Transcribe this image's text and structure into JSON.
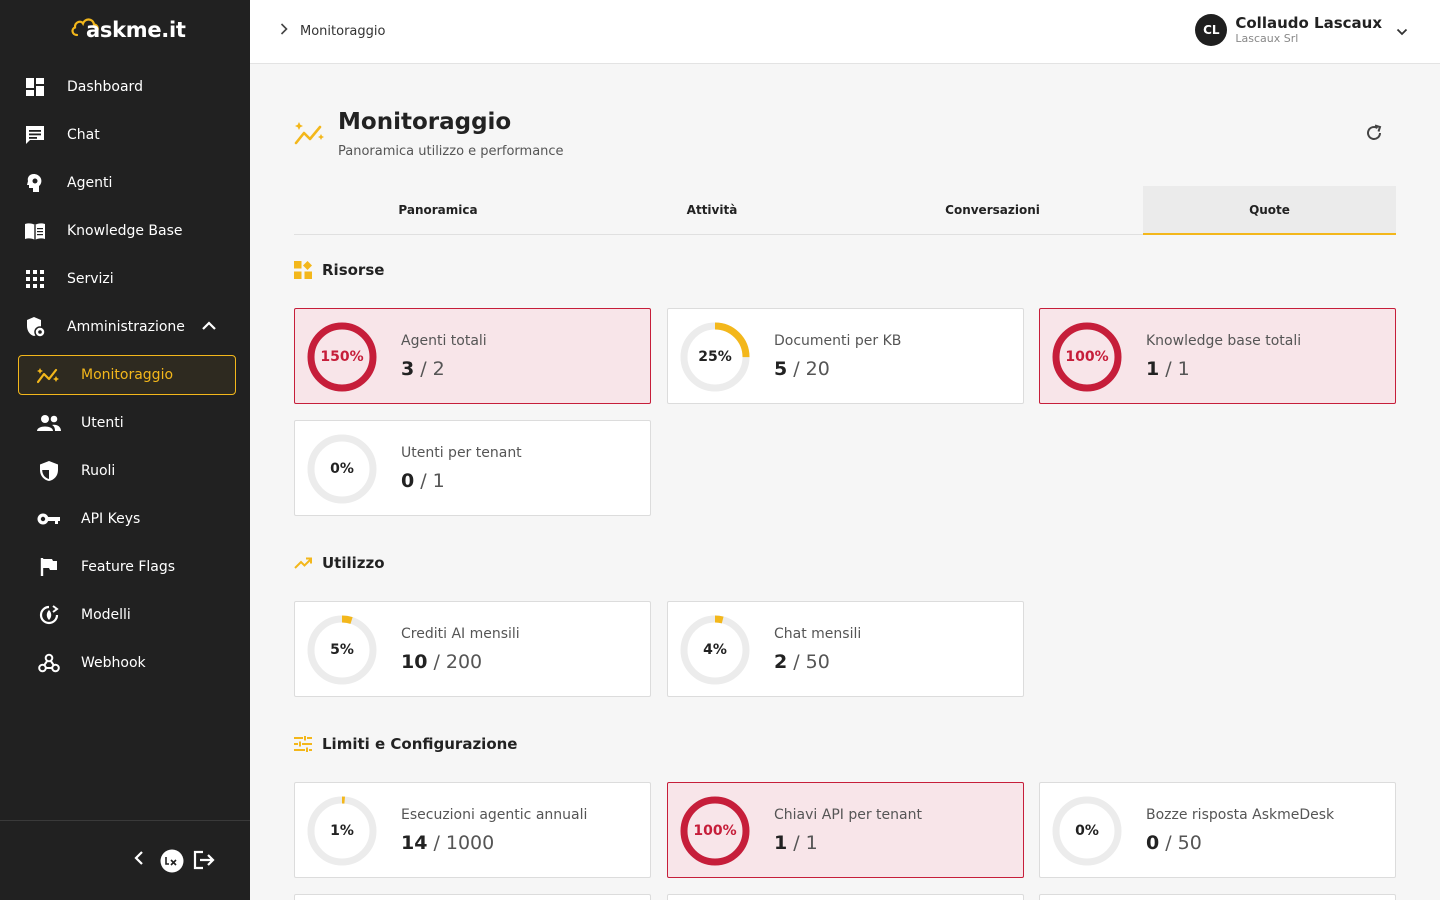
{
  "brand": {
    "name": "askme.it",
    "accent": "#f3b71b",
    "danger": "#c61e3a"
  },
  "sidebar": {
    "items": [
      {
        "label": "Dashboard",
        "icon": "dashboard-icon"
      },
      {
        "label": "Chat",
        "icon": "chat-icon"
      },
      {
        "label": "Agenti",
        "icon": "agent-head-icon"
      },
      {
        "label": "Knowledge Base",
        "icon": "book-icon"
      },
      {
        "label": "Servizi",
        "icon": "apps-grid-icon"
      },
      {
        "label": "Amministrazione",
        "icon": "admin-gear-icon"
      }
    ],
    "admin_items": [
      {
        "label": "Monitoraggio",
        "icon": "monitoring-icon"
      },
      {
        "label": "Utenti",
        "icon": "users-icon"
      },
      {
        "label": "Ruoli",
        "icon": "shield-icon"
      },
      {
        "label": "API Keys",
        "icon": "key-icon"
      },
      {
        "label": "Feature Flags",
        "icon": "flag-icon"
      },
      {
        "label": "Modelli",
        "icon": "model-icon"
      },
      {
        "label": "Webhook",
        "icon": "webhook-icon"
      }
    ]
  },
  "header": {
    "breadcrumb": "Monitoraggio",
    "user": {
      "initials": "CL",
      "name": "Collaudo Lascaux",
      "org": "Lascaux Srl"
    }
  },
  "page": {
    "title": "Monitoraggio",
    "subtitle": "Panoramica utilizzo e performance",
    "tabs": [
      {
        "label": "Panoramica",
        "active": false
      },
      {
        "label": "Attività",
        "active": false
      },
      {
        "label": "Conversazioni",
        "active": false
      },
      {
        "label": "Quote",
        "active": true
      }
    ]
  },
  "sections": [
    {
      "title": "Risorse",
      "cards": [
        {
          "label": "Agenti totali",
          "used": "3",
          "max": "2",
          "percent": "150%",
          "fraction": 1.5,
          "over": true
        },
        {
          "label": "Documenti per KB",
          "used": "5",
          "max": "20",
          "percent": "25%",
          "fraction": 0.25,
          "over": false
        },
        {
          "label": "Knowledge base totali",
          "used": "1",
          "max": "1",
          "percent": "100%",
          "fraction": 1.0,
          "over": true
        },
        {
          "label": "Utenti per tenant",
          "used": "0",
          "max": "1",
          "percent": "0%",
          "fraction": 0,
          "over": false
        }
      ]
    },
    {
      "title": "Utilizzo",
      "cards": [
        {
          "label": "Crediti AI mensili",
          "used": "10",
          "max": "200",
          "percent": "5%",
          "fraction": 0.05,
          "over": false
        },
        {
          "label": "Chat mensili",
          "used": "2",
          "max": "50",
          "percent": "4%",
          "fraction": 0.04,
          "over": false
        }
      ]
    },
    {
      "title": "Limiti e Configurazione",
      "cards": [
        {
          "label": "Esecuzioni agentic annuali",
          "used": "14",
          "max": "1000",
          "percent": "1%",
          "fraction": 0.014,
          "over": false
        },
        {
          "label": "Chiavi API per tenant",
          "used": "1",
          "max": "1",
          "percent": "100%",
          "fraction": 1.0,
          "over": true
        },
        {
          "label": "Bozze risposta AskmeDesk",
          "used": "0",
          "max": "50",
          "percent": "0%",
          "fraction": 0,
          "over": false
        }
      ]
    }
  ]
}
